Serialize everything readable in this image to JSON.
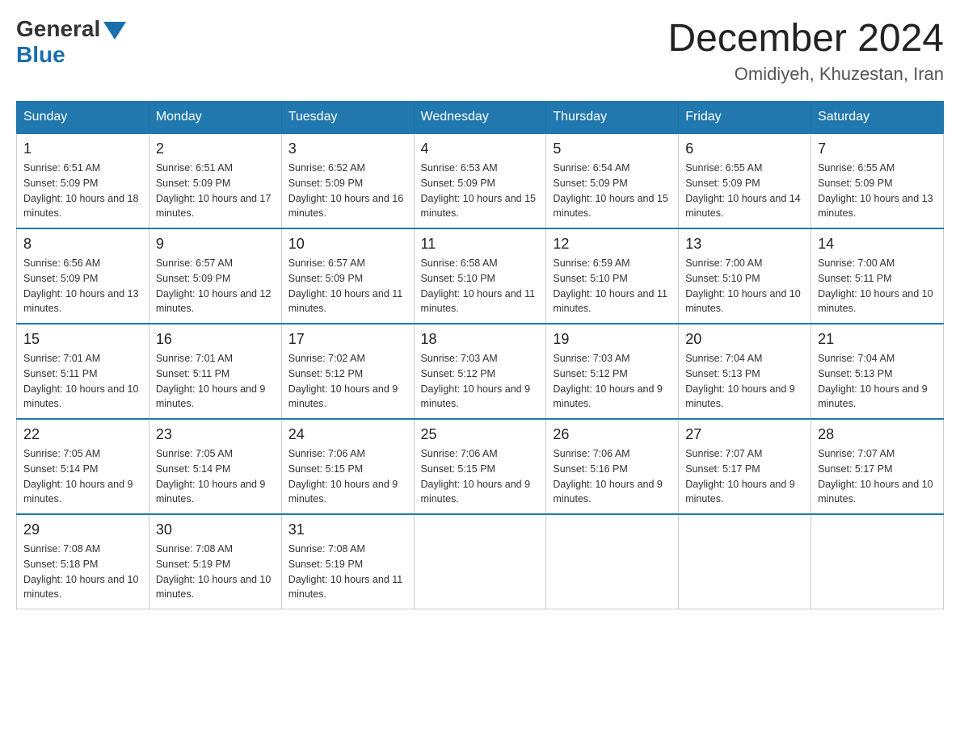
{
  "header": {
    "logo_general": "General",
    "logo_blue": "Blue",
    "month_title": "December 2024",
    "location": "Omidiyeh, Khuzestan, Iran"
  },
  "days_of_week": [
    "Sunday",
    "Monday",
    "Tuesday",
    "Wednesday",
    "Thursday",
    "Friday",
    "Saturday"
  ],
  "weeks": [
    [
      {
        "day": "1",
        "sunrise": "6:51 AM",
        "sunset": "5:09 PM",
        "daylight": "10 hours and 18 minutes."
      },
      {
        "day": "2",
        "sunrise": "6:51 AM",
        "sunset": "5:09 PM",
        "daylight": "10 hours and 17 minutes."
      },
      {
        "day": "3",
        "sunrise": "6:52 AM",
        "sunset": "5:09 PM",
        "daylight": "10 hours and 16 minutes."
      },
      {
        "day": "4",
        "sunrise": "6:53 AM",
        "sunset": "5:09 PM",
        "daylight": "10 hours and 15 minutes."
      },
      {
        "day": "5",
        "sunrise": "6:54 AM",
        "sunset": "5:09 PM",
        "daylight": "10 hours and 15 minutes."
      },
      {
        "day": "6",
        "sunrise": "6:55 AM",
        "sunset": "5:09 PM",
        "daylight": "10 hours and 14 minutes."
      },
      {
        "day": "7",
        "sunrise": "6:55 AM",
        "sunset": "5:09 PM",
        "daylight": "10 hours and 13 minutes."
      }
    ],
    [
      {
        "day": "8",
        "sunrise": "6:56 AM",
        "sunset": "5:09 PM",
        "daylight": "10 hours and 13 minutes."
      },
      {
        "day": "9",
        "sunrise": "6:57 AM",
        "sunset": "5:09 PM",
        "daylight": "10 hours and 12 minutes."
      },
      {
        "day": "10",
        "sunrise": "6:57 AM",
        "sunset": "5:09 PM",
        "daylight": "10 hours and 11 minutes."
      },
      {
        "day": "11",
        "sunrise": "6:58 AM",
        "sunset": "5:10 PM",
        "daylight": "10 hours and 11 minutes."
      },
      {
        "day": "12",
        "sunrise": "6:59 AM",
        "sunset": "5:10 PM",
        "daylight": "10 hours and 11 minutes."
      },
      {
        "day": "13",
        "sunrise": "7:00 AM",
        "sunset": "5:10 PM",
        "daylight": "10 hours and 10 minutes."
      },
      {
        "day": "14",
        "sunrise": "7:00 AM",
        "sunset": "5:11 PM",
        "daylight": "10 hours and 10 minutes."
      }
    ],
    [
      {
        "day": "15",
        "sunrise": "7:01 AM",
        "sunset": "5:11 PM",
        "daylight": "10 hours and 10 minutes."
      },
      {
        "day": "16",
        "sunrise": "7:01 AM",
        "sunset": "5:11 PM",
        "daylight": "10 hours and 9 minutes."
      },
      {
        "day": "17",
        "sunrise": "7:02 AM",
        "sunset": "5:12 PM",
        "daylight": "10 hours and 9 minutes."
      },
      {
        "day": "18",
        "sunrise": "7:03 AM",
        "sunset": "5:12 PM",
        "daylight": "10 hours and 9 minutes."
      },
      {
        "day": "19",
        "sunrise": "7:03 AM",
        "sunset": "5:12 PM",
        "daylight": "10 hours and 9 minutes."
      },
      {
        "day": "20",
        "sunrise": "7:04 AM",
        "sunset": "5:13 PM",
        "daylight": "10 hours and 9 minutes."
      },
      {
        "day": "21",
        "sunrise": "7:04 AM",
        "sunset": "5:13 PM",
        "daylight": "10 hours and 9 minutes."
      }
    ],
    [
      {
        "day": "22",
        "sunrise": "7:05 AM",
        "sunset": "5:14 PM",
        "daylight": "10 hours and 9 minutes."
      },
      {
        "day": "23",
        "sunrise": "7:05 AM",
        "sunset": "5:14 PM",
        "daylight": "10 hours and 9 minutes."
      },
      {
        "day": "24",
        "sunrise": "7:06 AM",
        "sunset": "5:15 PM",
        "daylight": "10 hours and 9 minutes."
      },
      {
        "day": "25",
        "sunrise": "7:06 AM",
        "sunset": "5:15 PM",
        "daylight": "10 hours and 9 minutes."
      },
      {
        "day": "26",
        "sunrise": "7:06 AM",
        "sunset": "5:16 PM",
        "daylight": "10 hours and 9 minutes."
      },
      {
        "day": "27",
        "sunrise": "7:07 AM",
        "sunset": "5:17 PM",
        "daylight": "10 hours and 9 minutes."
      },
      {
        "day": "28",
        "sunrise": "7:07 AM",
        "sunset": "5:17 PM",
        "daylight": "10 hours and 10 minutes."
      }
    ],
    [
      {
        "day": "29",
        "sunrise": "7:08 AM",
        "sunset": "5:18 PM",
        "daylight": "10 hours and 10 minutes."
      },
      {
        "day": "30",
        "sunrise": "7:08 AM",
        "sunset": "5:19 PM",
        "daylight": "10 hours and 10 minutes."
      },
      {
        "day": "31",
        "sunrise": "7:08 AM",
        "sunset": "5:19 PM",
        "daylight": "10 hours and 11 minutes."
      },
      null,
      null,
      null,
      null
    ]
  ]
}
